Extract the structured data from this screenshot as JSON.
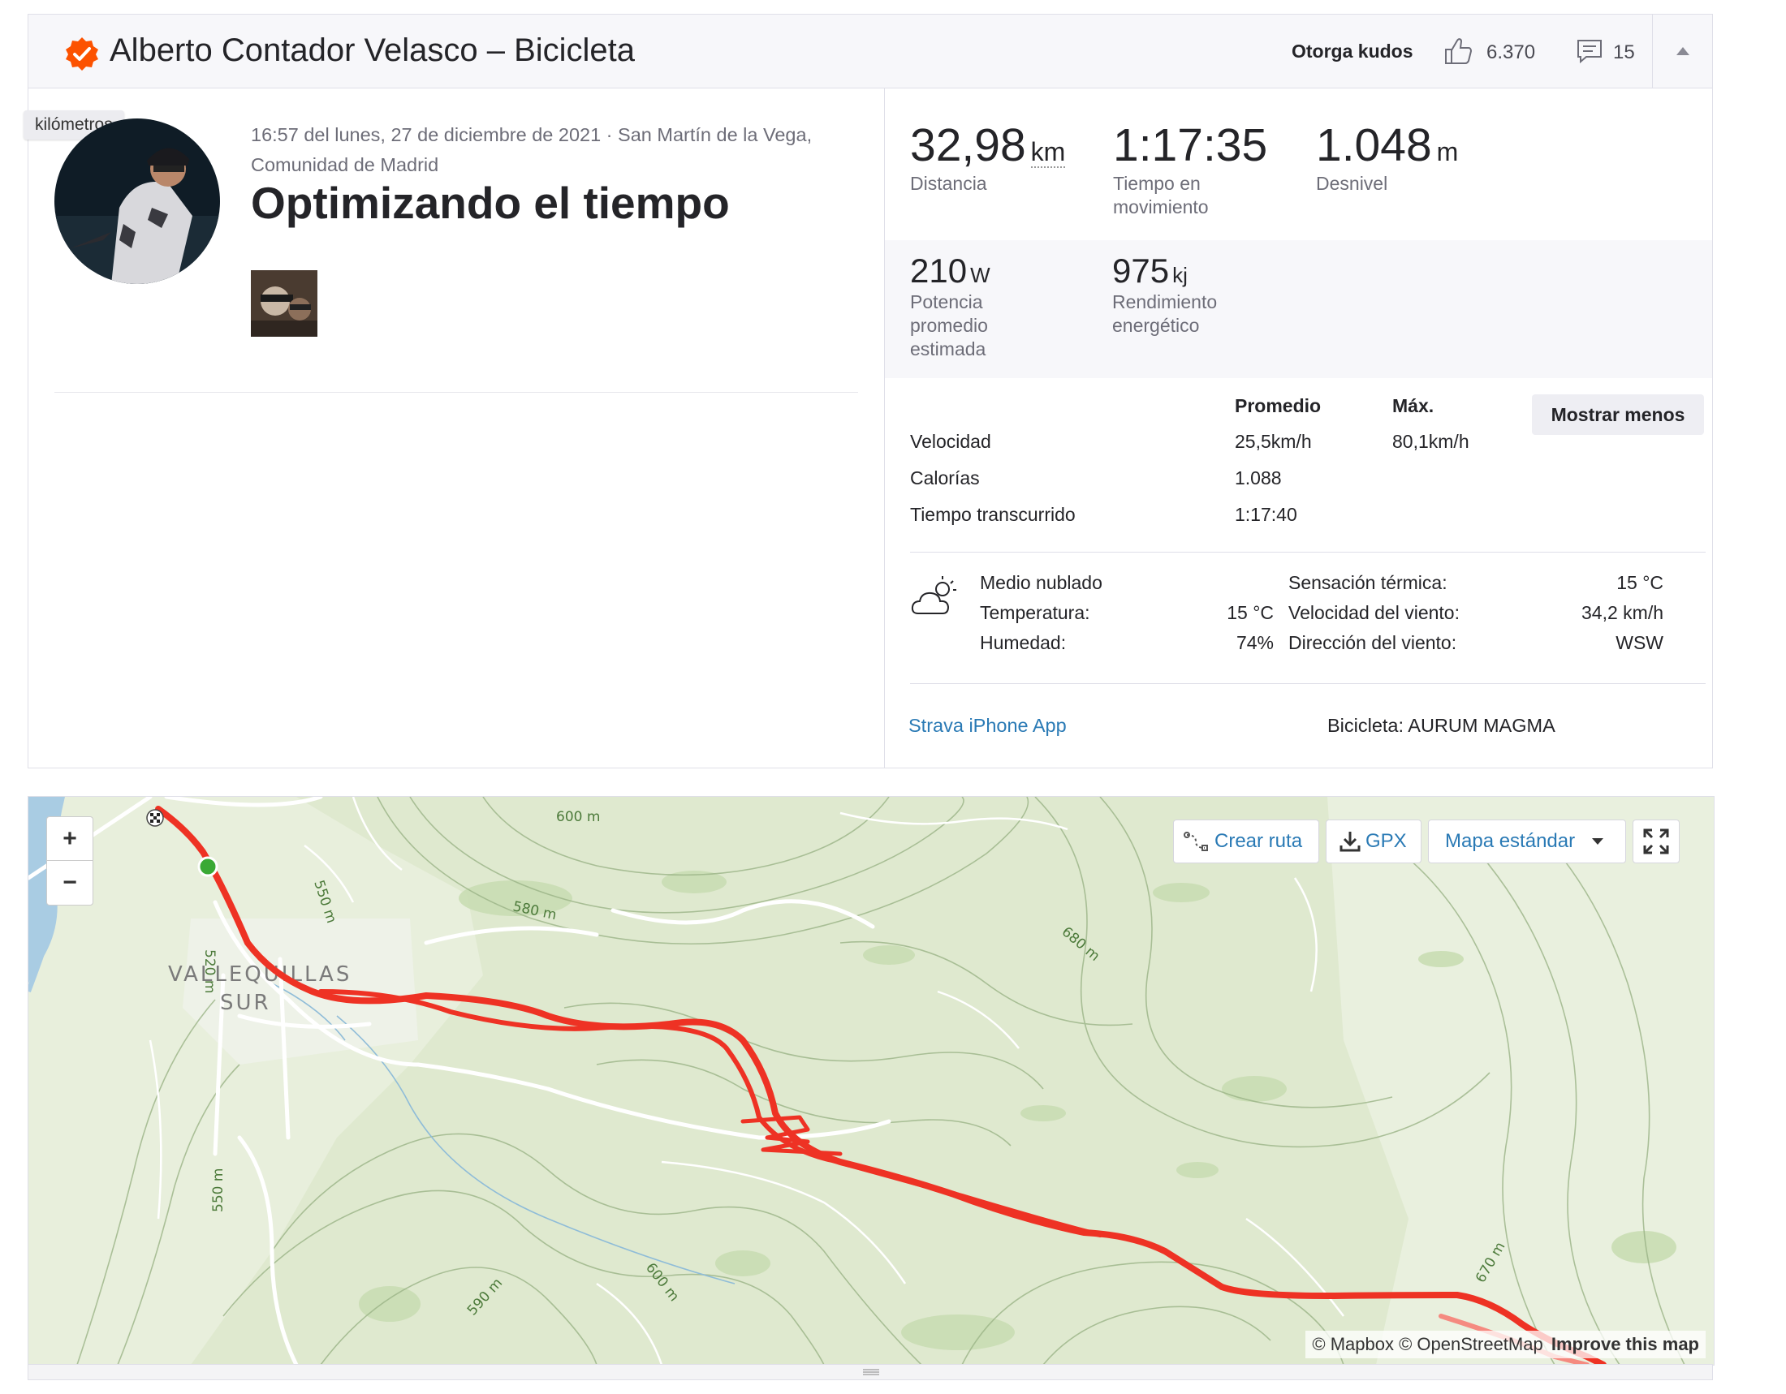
{
  "header": {
    "athlete_title": "Alberto Contador Velasco – Bicicleta",
    "kudos_label": "Otorga kudos",
    "kudos_count": "6.370",
    "comments_count": "15",
    "badge_color": "#fc5200"
  },
  "tooltip": "kilómetros",
  "activity": {
    "datetime": "16:57 del lunes, 27 de diciembre de 2021 · San Martín de la Vega, Comunidad de Madrid",
    "title": "Optimizando el tiempo"
  },
  "stats": {
    "distance": {
      "value": "32,98",
      "unit": "km",
      "label": "Distancia"
    },
    "moving_time": {
      "value": "1:17:35",
      "label": "Tiempo en movimiento"
    },
    "elevation": {
      "value": "1.048",
      "unit": "m",
      "label": "Desnivel"
    },
    "power": {
      "value": "210",
      "unit": "W",
      "label": "Potencia promedio estimada"
    },
    "energy": {
      "value": "975",
      "unit": "kj",
      "label": "Rendimiento energético"
    }
  },
  "details": {
    "col_avg": "Promedio",
    "col_max": "Máx.",
    "show_less": "Mostrar menos",
    "rows": [
      {
        "label": "Velocidad",
        "avg": "25,5km/h",
        "max": "80,1km/h"
      },
      {
        "label": "Calorías",
        "avg": "1.088",
        "max": ""
      },
      {
        "label": "Tiempo transcurrido",
        "avg": "1:17:40",
        "max": ""
      }
    ]
  },
  "weather": {
    "condition": "Medio nublado",
    "temp_label": "Temperatura:",
    "temp_value": "15 °C",
    "humidity_label": "Humedad:",
    "humidity_value": "74%",
    "feels_label": "Sensación térmica:",
    "feels_value": "15 °C",
    "wind_speed_label": "Velocidad del viento:",
    "wind_speed_value": "34,2 km/h",
    "wind_dir_label": "Dirección del viento:",
    "wind_dir_value": "WSW"
  },
  "footer": {
    "app": "Strava iPhone App",
    "bike": "Bicicleta: AURUM MAGMA"
  },
  "map": {
    "zoom_in": "+",
    "zoom_out": "−",
    "create_route": "Crear ruta",
    "gpx": "GPX",
    "map_style": "Mapa estándar",
    "place_line1": "VALLEQUILLAS",
    "place_line2": "SUR",
    "contours": [
      "600 m",
      "580 m",
      "550 m",
      "520 m",
      "680 m",
      "550 m",
      "590 m",
      "600 m",
      "670 m"
    ],
    "attribution_a": "© Mapbox © OpenStreetMap",
    "attribution_b": "Improve this map",
    "route_color": "#ee3224",
    "start_color": "#3aa935"
  }
}
